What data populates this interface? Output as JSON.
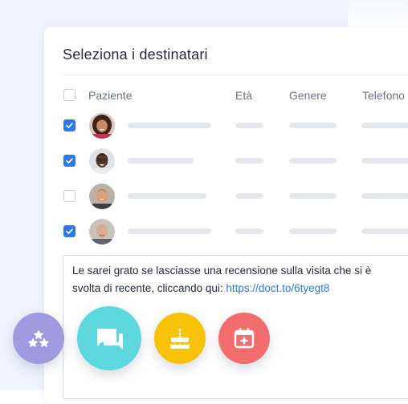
{
  "dialog": {
    "title": "Seleziona i destinatari"
  },
  "table": {
    "columns": [
      "Paziente",
      "Età",
      "Genere",
      "Telefono"
    ],
    "rows": [
      {
        "checked": true,
        "avatar": "woman-avatar"
      },
      {
        "checked": true,
        "avatar": "man-glasses-avatar"
      },
      {
        "checked": false,
        "avatar": "man-beard-avatar"
      },
      {
        "checked": true,
        "avatar": "older-man-avatar"
      }
    ]
  },
  "message": {
    "text": "Le sarei grato se lasciasse una recensione sulla visita che si è svolta di recente, cliccando qui: ",
    "link": "https://doct.to/6tyegt8"
  },
  "actions": [
    {
      "icon": "stars-icon",
      "color": "#9f9be0"
    },
    {
      "icon": "chat-icon",
      "color": "#5dd8de"
    },
    {
      "icon": "cake-icon",
      "color": "#f7c30a"
    },
    {
      "icon": "calendar-plus-icon",
      "color": "#f26e6e"
    }
  ],
  "colors": {
    "accent": "#2f78e8",
    "background": "#eef4fe"
  }
}
